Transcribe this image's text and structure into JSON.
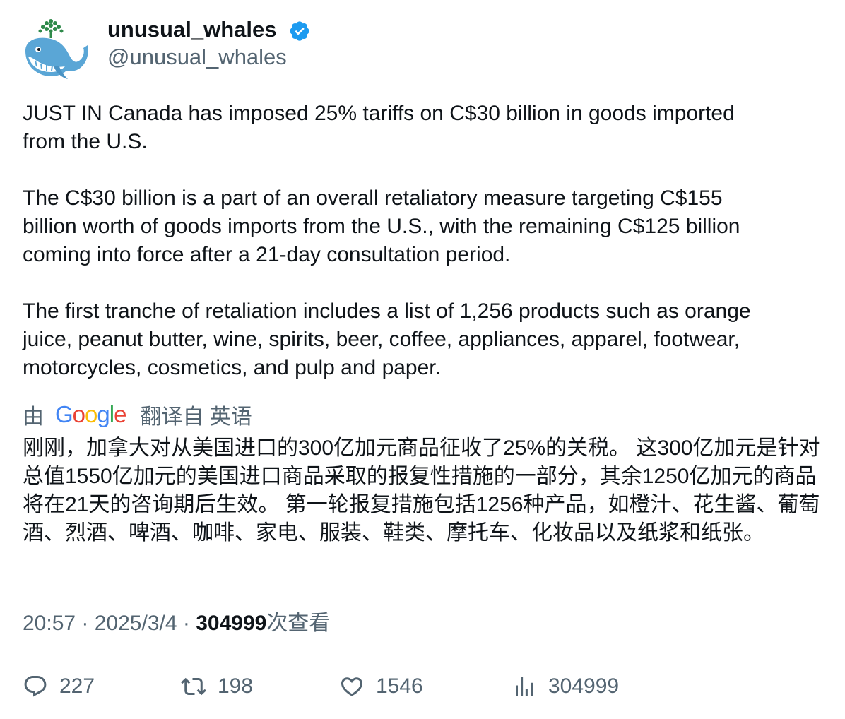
{
  "author": {
    "display_name": "unusual_whales",
    "handle": "@unusual_whales",
    "verified": true,
    "avatar_icon": "whale-logo-icon",
    "verified_icon": "verified-badge-icon"
  },
  "tweet": {
    "paragraphs": [
      "JUST IN Canada has imposed 25% tariffs on C$30 billion in goods imported\nfrom the U.S.",
      "The C$30 billion is a part of an overall retaliatory measure targeting C$155\nbillion worth of goods imports from the U.S., with the remaining C$125 billion\ncoming into force after a 21-day consultation period.",
      "The first tranche of retaliation includes a list of 1,256 products such as orange\njuice, peanut butter, wine, spirits, beer, coffee, appliances, apparel, footwear,\nmotorcycles, cosmetics, and pulp and paper."
    ]
  },
  "translation": {
    "by_label": "由",
    "provider": "Google",
    "translated_from": "翻译自 英语",
    "text": "刚刚，加拿大对从美国进口的300亿加元商品征收了25%的关税。 这300亿加元是针对总值1550亿加元的美国进口商品采取的报复性措施的一部分，其余1250亿加元的商品将在21天的咨询期后生效。 第一轮报复措施包括1256种产品，如橙汁、花生酱、葡萄酒、烈酒、啤酒、咖啡、家电、服装、鞋类、摩托车、化妆品以及纸浆和纸张。"
  },
  "meta": {
    "time": "20:57",
    "separator": " · ",
    "date": "2025/3/4",
    "views_count": "304999",
    "views_label": "次查看"
  },
  "actions": {
    "replies": "227",
    "retweets": "198",
    "likes": "1546",
    "views": "304999"
  },
  "colors": {
    "text_primary": "#0f1419",
    "text_secondary": "#536471",
    "verified_blue": "#1d9bf0"
  }
}
